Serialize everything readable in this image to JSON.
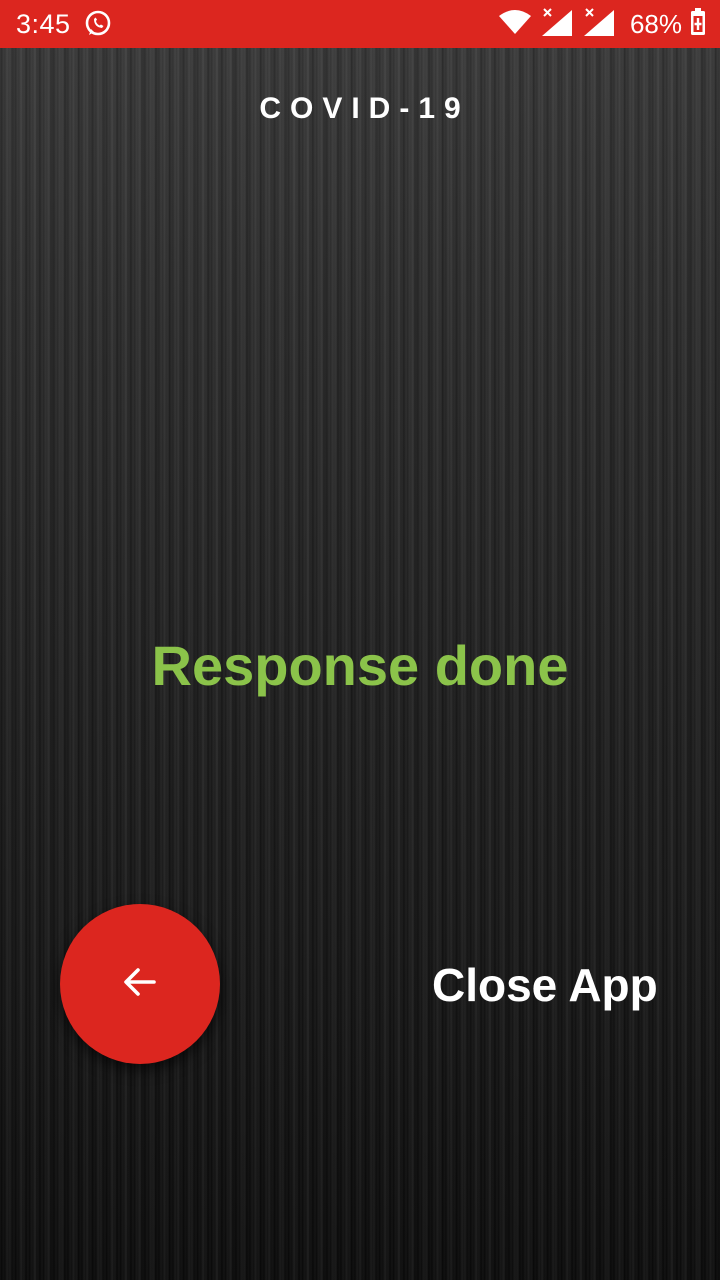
{
  "status_bar": {
    "time": "3:45",
    "battery": "68%",
    "background_color": "#dc261f",
    "icons": [
      "whatsapp-icon",
      "wifi-icon",
      "signal-icon",
      "signal-icon",
      "battery-icon"
    ]
  },
  "app": {
    "title": "COVID-19",
    "message": "Response done",
    "message_color": "#8bc34a",
    "close_label": "Close App",
    "accent_color": "#dc261f",
    "back_icon": "arrow-left-icon"
  }
}
